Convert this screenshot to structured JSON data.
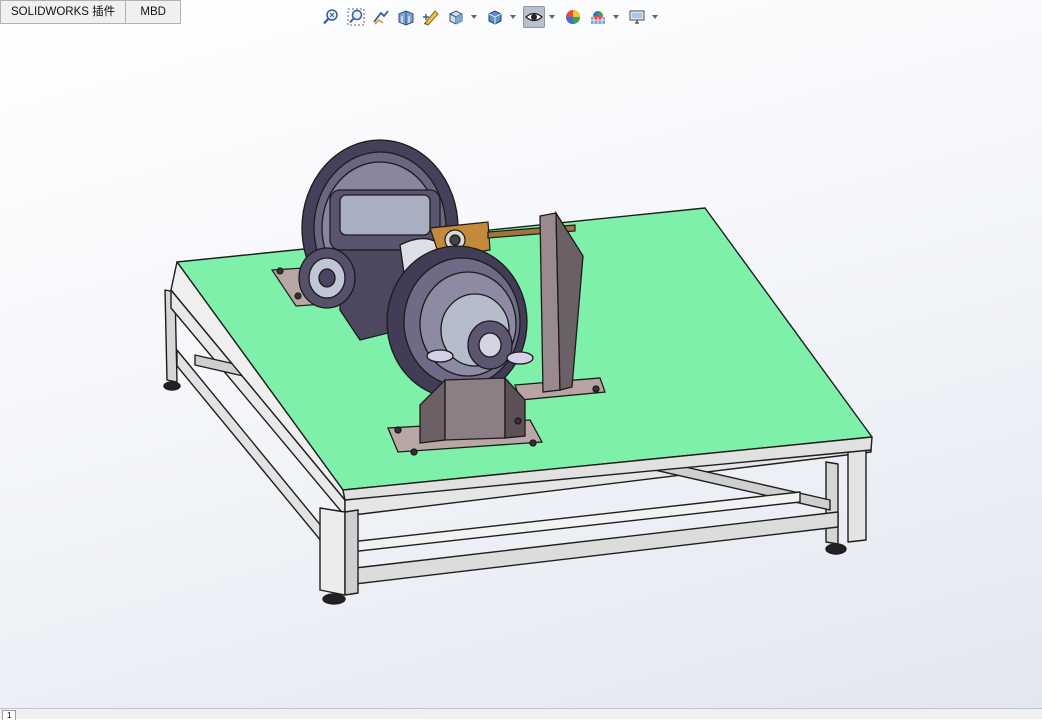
{
  "tabs": [
    {
      "label": "SOLIDWORKS 插件"
    },
    {
      "label": "MBD"
    }
  ],
  "hud_toolbar": {
    "buttons": [
      {
        "icon": "zoom-to-fit-icon"
      },
      {
        "icon": "zoom-to-area-icon"
      },
      {
        "icon": "previous-view-icon"
      },
      {
        "icon": "section-view-icon"
      },
      {
        "icon": "dynamic-annotation-icon"
      },
      {
        "icon": "view-orientation-icon"
      },
      {
        "icon": "display-style-icon"
      },
      {
        "icon": "hide-show-items-icon"
      },
      {
        "icon": "edit-appearance-icon"
      },
      {
        "icon": "apply-scene-icon"
      },
      {
        "icon": "view-setting-icon"
      }
    ]
  },
  "status": {
    "sheet_tab": "1"
  },
  "colors": {
    "table_top": "#7ef0a9",
    "frame": "#e5e5e5",
    "tab_bg": "#f0f0f0",
    "hud_active": "#b7c0cc"
  }
}
